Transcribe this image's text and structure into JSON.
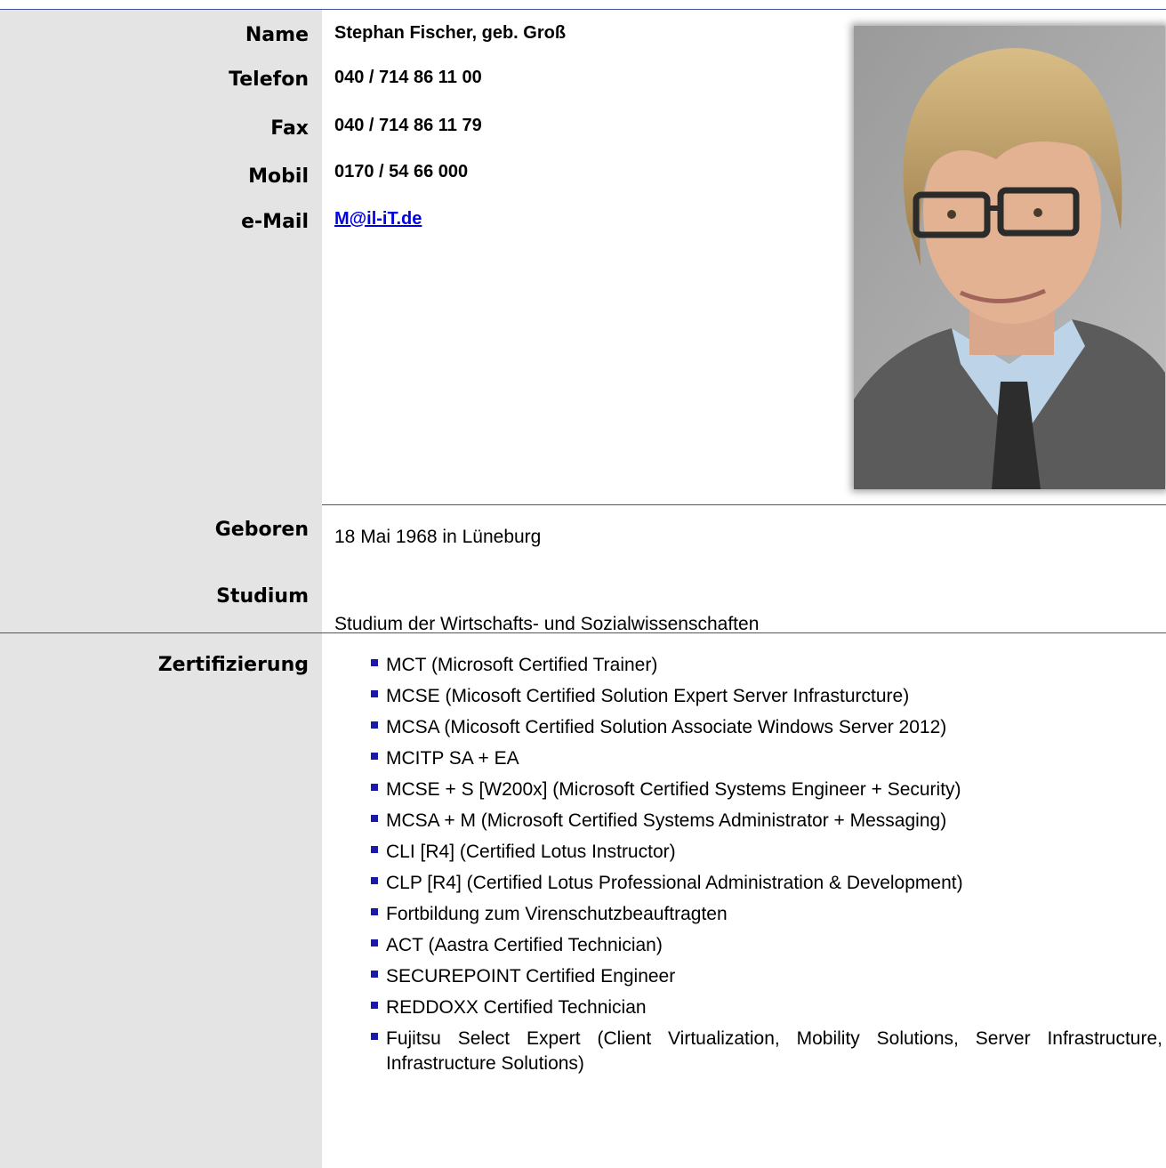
{
  "contact": {
    "name_label": "Name",
    "name_value": "Stephan Fischer, geb. Groß",
    "phone_label": "Telefon",
    "phone_value": "040 / 714 86 11 00",
    "fax_label": "Fax",
    "fax_value": "040 / 714 86 11 79",
    "mobile_label": "Mobil",
    "mobile_value": "0170 / 54 66 000",
    "email_label": "e-Mail",
    "email_value": "M@il-iT.de"
  },
  "photo": {
    "icon": "portrait-photo"
  },
  "personal": {
    "born_label": "Geboren",
    "born_value": "18 Mai 1968 in Lüneburg",
    "study_label": "Studium",
    "study_value": "Studium der Wirtschafts- und Sozialwissenschaften"
  },
  "certifications": {
    "label": "Zertifizierung",
    "items": [
      "MCT (Microsoft Certified Trainer)",
      "MCSE (Micosoft Certified Solution Expert Server Infrasturcture)",
      "MCSA (Micosoft Certified Solution Associate Windows Server 2012)",
      "MCITP SA + EA",
      "MCSE + S [W200x] (Microsoft Certified Systems Engineer + Security)",
      "MCSA + M (Microsoft Certified Systems Administrator + Messaging)",
      "CLI [R4] (Certified Lotus Instructor)",
      "CLP [R4] (Certified Lotus Professional Administration & Development)",
      "Fortbildung zum Virenschutzbeauftragten",
      "ACT (Aastra Certified Technician)",
      "SECUREPOINT Certified Engineer",
      "REDDOXX Certified Technician",
      "Fujitsu Select Expert (Client Virtualization, Mobility Solutions, Server Infrastructure, Infrastructure Solutions)"
    ]
  },
  "colors": {
    "rule": "#3f51a0",
    "label_column": "#e4e4e4",
    "bullet": "#1a1aa8",
    "link": "#0000e6"
  }
}
